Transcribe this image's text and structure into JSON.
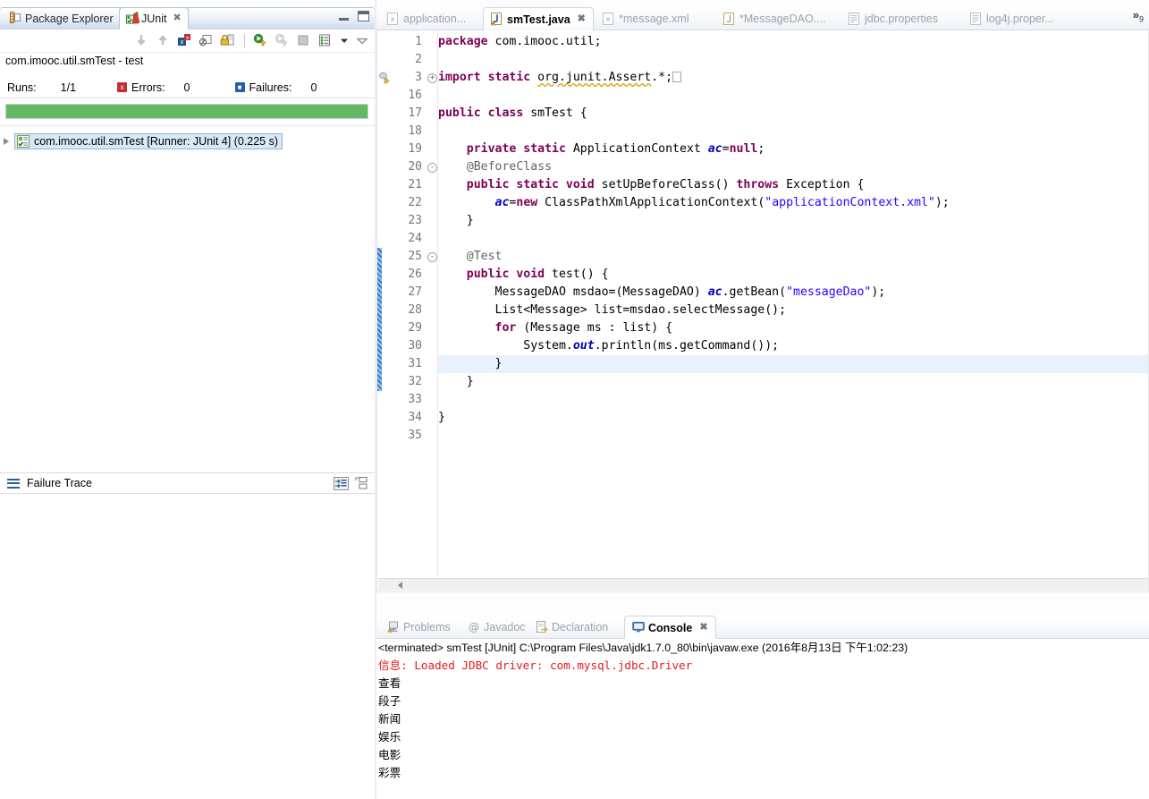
{
  "left_panel": {
    "tabs": [
      {
        "label": "Package Explorer",
        "icon": "package-explorer-icon",
        "active": false,
        "closable": false
      },
      {
        "label": "JUnit",
        "icon": "junit-icon",
        "active": true,
        "closable": true
      }
    ],
    "window_buttons": {
      "minimize": "Minimize",
      "maximize": "Maximize"
    },
    "toolbar_icons": [
      "next-failure-icon",
      "previous-failure-icon",
      "show-failures-only-icon",
      "stop-on-error-icon",
      "lock-icon",
      "rerun-test-icon",
      "rerun-failed-icon",
      "stop-icon",
      "test-run-history-icon",
      "view-menu-dropdown-icon",
      "view-menu-icon"
    ],
    "test_label": "com.imooc.util.smTest - test",
    "counters": {
      "runs_label": "Runs:",
      "runs_value": "1/1",
      "errors_label": "Errors:",
      "errors_value": "0",
      "failures_label": "Failures:",
      "failures_value": "0"
    },
    "progress": {
      "percent": 100,
      "color": "#63b863"
    },
    "tree": [
      {
        "label": "com.imooc.util.smTest [Runner: JUnit 4] (0.225 s)",
        "selected": true,
        "expandable": true
      }
    ],
    "failure_trace": {
      "label": "Failure Trace",
      "body": ""
    }
  },
  "editor_tabs": [
    {
      "label": "application...",
      "icon": "xml-file-icon",
      "active": false,
      "dirty": false
    },
    {
      "label": "smTest.java",
      "icon": "java-warning-file-icon",
      "active": true,
      "dirty": false
    },
    {
      "label": "*message.xml",
      "icon": "xml-file-icon",
      "active": false,
      "dirty": true
    },
    {
      "label": "*MessageDAO....",
      "icon": "java-file-icon",
      "active": false,
      "dirty": true
    },
    {
      "label": "jdbc.properties",
      "icon": "properties-file-icon",
      "active": false,
      "dirty": false
    },
    {
      "label": "log4j.proper...",
      "icon": "properties-file-icon",
      "active": false,
      "dirty": false
    }
  ],
  "editor_overflow": {
    "symbol": "»",
    "count": "9"
  },
  "editor": {
    "highlight_line": 31,
    "change_bar_from": 25,
    "change_bar_to": 32,
    "lines": [
      {
        "n": 1,
        "fold": "",
        "marker": "",
        "html": "<span class=\"kw\">package</span> com.imooc.util;"
      },
      {
        "n": 2,
        "fold": "",
        "marker": "",
        "html": ""
      },
      {
        "n": 3,
        "fold": "+",
        "marker": "import-warning-icon",
        "html": "<span class=\"kw\">import static</span> <span class=\"warnunder\">org.junit.Assert</span>.*;<span class=\"collapsed-box\"></span>"
      },
      {
        "n": 16,
        "fold": "",
        "marker": "",
        "html": ""
      },
      {
        "n": 17,
        "fold": "",
        "marker": "",
        "html": "<span class=\"kw\">public class</span> smTest {"
      },
      {
        "n": 18,
        "fold": "",
        "marker": "",
        "html": ""
      },
      {
        "n": 19,
        "fold": "",
        "marker": "",
        "html": "    <span class=\"kw\">private static</span> ApplicationContext <span class=\"stfld\">ac</span>=<span class=\"kw\">null</span>;"
      },
      {
        "n": 20,
        "fold": "-",
        "marker": "",
        "html": "    <span class=\"ann\">@BeforeClass</span>"
      },
      {
        "n": 21,
        "fold": "",
        "marker": "",
        "html": "    <span class=\"kw\">public static void</span> setUpBeforeClass() <span class=\"kw\">throws</span> Exception {"
      },
      {
        "n": 22,
        "fold": "",
        "marker": "",
        "html": "        <span class=\"stfld\">ac</span>=<span class=\"kw\">new</span> ClassPathXmlApplicationContext(<span class=\"str\">\"applicationContext.xml\"</span>);"
      },
      {
        "n": 23,
        "fold": "",
        "marker": "",
        "html": "    }"
      },
      {
        "n": 24,
        "fold": "",
        "marker": "",
        "html": ""
      },
      {
        "n": 25,
        "fold": "-",
        "marker": "",
        "html": "    <span class=\"ann\">@Test</span>"
      },
      {
        "n": 26,
        "fold": "",
        "marker": "",
        "html": "    <span class=\"kw\">public void</span> test() {"
      },
      {
        "n": 27,
        "fold": "",
        "marker": "",
        "html": "        MessageDAO msdao=(MessageDAO) <span class=\"stfld\">ac</span>.getBean(<span class=\"str\">\"messageDao\"</span>);"
      },
      {
        "n": 28,
        "fold": "",
        "marker": "",
        "html": "        List&lt;Message&gt; list=msdao.selectMessage();"
      },
      {
        "n": 29,
        "fold": "",
        "marker": "",
        "html": "        <span class=\"kw\">for</span> (Message ms : list) {"
      },
      {
        "n": 30,
        "fold": "",
        "marker": "",
        "html": "            System.<span class=\"stfld\">out</span>.println(ms.getCommand());"
      },
      {
        "n": 31,
        "fold": "",
        "marker": "",
        "html": "        }"
      },
      {
        "n": 32,
        "fold": "",
        "marker": "",
        "html": "    }"
      },
      {
        "n": 33,
        "fold": "",
        "marker": "",
        "html": ""
      },
      {
        "n": 34,
        "fold": "",
        "marker": "",
        "html": "}"
      },
      {
        "n": 35,
        "fold": "",
        "marker": "",
        "html": ""
      }
    ]
  },
  "console_tabs": [
    {
      "label": "Problems",
      "icon": "problems-icon",
      "active": false,
      "closable": false
    },
    {
      "label": "Javadoc",
      "icon": "javadoc-at-icon",
      "active": false,
      "closable": false
    },
    {
      "label": "Declaration",
      "icon": "declaration-icon",
      "active": false,
      "closable": false
    },
    {
      "label": "Console",
      "icon": "console-monitor-icon",
      "active": true,
      "closable": true
    }
  ],
  "console": {
    "header": "<terminated> smTest [JUnit] C:\\Program Files\\Java\\jdk1.7.0_80\\bin\\javaw.exe (2016年8月13日 下午1:02:23)",
    "lines": [
      {
        "text": "信息: Loaded JDBC driver: com.mysql.jdbc.Driver",
        "color": "#e41b1b"
      },
      {
        "text": "查看",
        "color": "#000000"
      },
      {
        "text": "段子",
        "color": "#000000"
      },
      {
        "text": "新闻",
        "color": "#000000"
      },
      {
        "text": "娱乐",
        "color": "#000000"
      },
      {
        "text": "电影",
        "color": "#000000"
      },
      {
        "text": "彩票",
        "color": "#000000"
      }
    ]
  },
  "colors": {
    "progress_green": "#63b863",
    "selection_blue": "#d7e8f7",
    "keyword_purple": "#7f0055",
    "string_blue": "#2a00ff",
    "error_red": "#e41b1b",
    "change_bar_blue": "#3a7fc1",
    "highlight_line": "#e8f2fe"
  }
}
